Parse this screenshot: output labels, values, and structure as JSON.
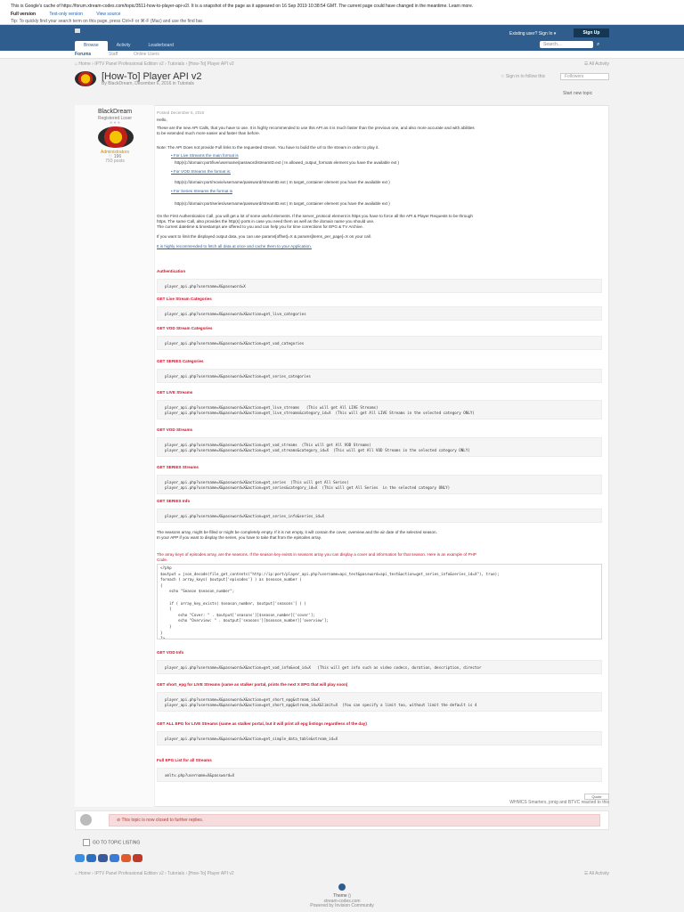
{
  "cache_bar": {
    "line1": "This is Google's cache of https://forum.xtream-codes.com/topic/3511-how-to-player-api-v2/. It is a snapshot of the page as it appeared on 16 Sep 2019 10:38:54 GMT. The current page could have changed in the meantime. Learn more.",
    "full_version": "Full version",
    "text_only": "Text-only version",
    "view_source": "View source",
    "tip": "Tip: To quickly find your search term on this page, press Ctrl+F or ⌘-F (Mac) and use the find bar."
  },
  "header": {
    "signin_label": "Existing user? Sign In ▾",
    "signup_label": "Sign Up",
    "search_placeholder": "Search...",
    "search_icon": "search-icon",
    "nav": [
      "Browse",
      "Activity",
      "Leaderboard"
    ],
    "subnav": [
      "Forums",
      "Staff",
      "Online Users"
    ]
  },
  "breadcrumb": {
    "path": "⌂ Home  ›  IPTV Panel Professional Edition v2  ›  Tutorials  ›  [How-To] Player API v2",
    "all_activity": "☰ All Activity"
  },
  "topic": {
    "title": "[How-To] Player API v2",
    "byline": "By BlackDream, December 6, 2016 in Tutorials",
    "follow_label": "☆ Sign in to follow this",
    "follow_count": "Followers",
    "start_new_topic": "Start new topic"
  },
  "author": {
    "name": "BlackDream",
    "rank": "Registered Loser",
    "pips": "● ● ●",
    "group": "Administrators",
    "count": "♡ 196",
    "posts": "793 posts"
  },
  "post": {
    "posted": "Posted December 6, 2016",
    "hello": "Hello,",
    "intro1": "These are the new API Calls, that you have to use. It is highly recommended to use this API as it is much faster than the previous one, and also more accurate and with abilities",
    "intro2": "to be extended much more easier and faster than before.",
    "note": "Note: The API Does not provide Full links to the requested stream. You have to build the url to the stream in order to play it.",
    "live_head": "• For Live Streams the main format is",
    "live_fmt": "http(s)://domain:port/live/username/password/streamID.ext  ( In  allowed_output_formats element you have the available ext )",
    "vod_head": "• For VOD Streams the format is:",
    "vod_fmt": "http(s)://domain:port/movie/username/password/streamID.ext  ( In  target_container element you have the available ext )",
    "series_head": "• For Series Streams the format is",
    "series_fmt": "http(s)://domain:port/series/username/password/streamID.ext  ( In  target_container element you have the available ext )",
    "auth1": "On the First Authentication Call, you will get a lot of some useful elements. If the server_protocol element is https you have to force all the API & Player Requests to be through",
    "auth2": "https. The same Call, also provides the http(s) ports in case you need them as well as the domain name you should use.",
    "auth3": "The current datetime & timestamps are offered to you and can help you for time corrections for EPG & TV Archive.",
    "limit": "If you want to limit the displayed output data, you can use params[offset]=X & params[items_per_page]=X on your call.",
    "fetch": "It is highly recommended to fetch all data at once and cache them to your Application.",
    "sections": [
      {
        "title": "Authentication",
        "code": [
          "player_api.php?username=X&password=X"
        ]
      },
      {
        "title": "GET Live Stream Categories",
        "code": [
          "player_api.php?username=X&password=X&action=get_live_categories"
        ]
      },
      {
        "title": "GET VOD Stream Categories",
        "code": [
          "player_api.php?username=X&password=X&action=get_vod_categories"
        ]
      },
      {
        "title": "GET SERIES Categories",
        "code": [
          "player_api.php?username=X&password=X&action=get_series_categories"
        ]
      },
      {
        "title": "GET LIVE Streams",
        "code": [
          "player_api.php?username=X&password=X&action=get_live_streams   (This will get All LIVE Streams)",
          "player_api.php?username=X&password=X&action=get_live_streams&category_id=X  (This will get All LIVE Streams in the selected category ONLY)"
        ]
      },
      {
        "title": "GET VOD Streams",
        "code": [
          "player_api.php?username=X&password=X&action=get_vod_streams  (This will get All VOD Streams)",
          "player_api.php?username=X&password=X&action=get_vod_streams&category_id=X  (This will get All VOD Streams in the selected category ONLY)"
        ]
      },
      {
        "title": "GET SERIES Streams",
        "code": [
          "player_api.php?username=X&password=X&action=get_series  (This will get All Series)",
          "player_api.php?username=X&password=X&action=get_series&category_id=X  (This will get All Series  in the selected category ONLY)"
        ]
      },
      {
        "title": "GET SERIES Info",
        "code": [
          "player_api.php?username=X&password=X&action=get_series_info&series_id=X"
        ]
      }
    ],
    "seasons1": "The seasons array, might be filled or might be completely empty. If it is not empty, it will contain the cover, overview and the air date of the selected season.",
    "seasons2": "In your APP if you want to display the series, you have to take that from the episodes array.",
    "array_keys1": "The array keys of episodes array, are the seasons.  If the season key exists in seasons array you can display a cover and information for that season. Here is an example of PHP",
    "array_keys2": "Code.",
    "php_code": "<?php\n$output = json_decode(file_get_contents(\"http://ip:port/player_api.php?username=api_test&password=api_test&action=get_series_info&series_id=X\"), true);\nforeach ( array_keys( $output['episodes'] ) as $season_number )\n{\n    echo \"Season $season_number\";\n\n    if ( array_key_exists( $season_number, $output['seasons'] ) )\n    {\n        echo \"Cover: \" . $output['seasons'][$season_number]['cover'];\n        echo \"Overview: \" . $output['seasons'][$season_number]['overview'];\n    }\n}\n?>",
    "sections2": [
      {
        "title": "GET VOD Info",
        "code": [
          "player_api.php?username=X&password=X&action=get_vod_info&vod_id=X   (This will get info such as video codecs, duration, description, director"
        ]
      },
      {
        "title": "GET short_epg for LIVE Streams (same as stalker portal, prints the next X EPG that will play soon)",
        "code": [
          "player_api.php?username=X&password=X&action=get_short_epg&stream_id=X",
          "player_api.php?username=X&password=X&action=get_short_epg&stream_id=X&limit=X  (You can specify a limit too, without limit the default is 4"
        ]
      },
      {
        "title": " GET ALL EPG for LIVE Streams (same as stalker portal, but it will print all epg listings regardless of the day)",
        "code": [
          "player_api.php?username=X&password=X&action=get_simple_data_table&stream_id=X"
        ]
      },
      {
        "title": "Full EPG List for all Streams",
        "code": [
          "xmltv.php?username=X&password=X"
        ]
      }
    ],
    "quote_label": "Quote",
    "reactors": "WHMCS Smarters, jonig and BTVC reacted to this"
  },
  "locked": {
    "message": "⊘ This topic is now closed to further replies."
  },
  "goto_label": "GO TO TOPIC LISTING",
  "share_colors": [
    "#3b8ee0",
    "#2b6fc0",
    "#3c5a99",
    "#3a7bd5",
    "#e05a2b",
    "#c0392b"
  ],
  "footer": {
    "theme": "Theme ▯",
    "site": "xtream-codes.com",
    "powered": "Powered by Invision Community"
  }
}
